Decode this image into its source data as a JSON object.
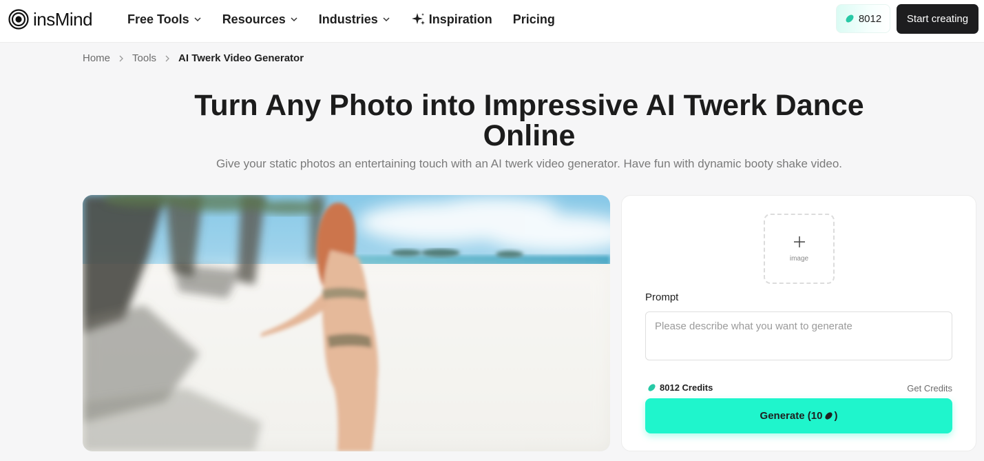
{
  "brand": {
    "name": "insMind"
  },
  "nav": {
    "items": [
      {
        "label": "Free Tools",
        "has_dropdown": true
      },
      {
        "label": "Resources",
        "has_dropdown": true
      },
      {
        "label": "Industries",
        "has_dropdown": true
      },
      {
        "label": "Inspiration",
        "icon": "sparkle-icon"
      },
      {
        "label": "Pricing"
      }
    ],
    "credits": "8012",
    "start_label": "Start creating"
  },
  "breadcrumb": {
    "home": "Home",
    "tools": "Tools",
    "current": "AI Twerk Video Generator"
  },
  "hero": {
    "title": "Turn Any Photo into Impressive AI Twerk Dance Online",
    "subtitle": "Give your static photos an entertaining touch with an AI twerk video generator. Have fun with dynamic booty shake video."
  },
  "panel": {
    "upload_label": "image",
    "prompt_label": "Prompt",
    "prompt_placeholder": "Please describe what you want to generate",
    "credits_text": "8012 Credits",
    "get_credits": "Get Credits",
    "generate_prefix": "Generate (10",
    "generate_suffix": ")"
  },
  "colors": {
    "accent": "#1ff5cc",
    "credit_icon": "#27c9a6",
    "dark_button": "#1d1d1f"
  }
}
